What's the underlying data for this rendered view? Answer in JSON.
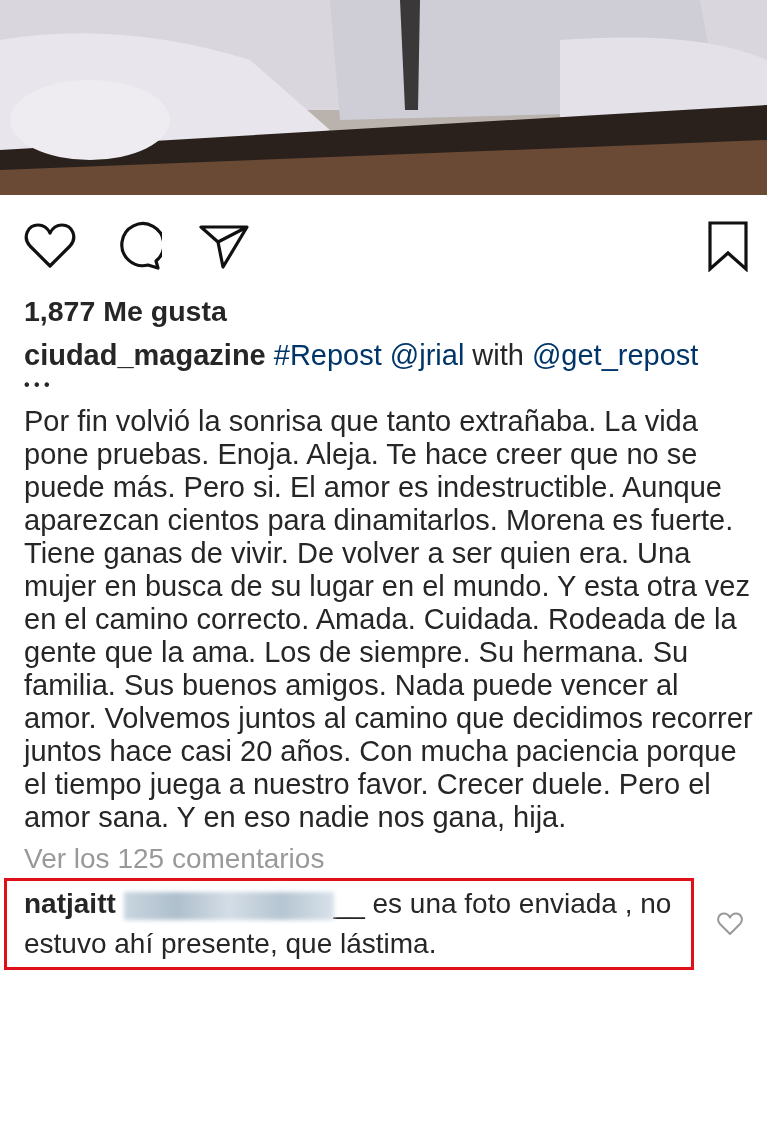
{
  "post": {
    "actions": [
      {
        "kind": "like"
      },
      {
        "kind": "comment"
      },
      {
        "kind": "share"
      },
      {
        "kind": "save"
      }
    ],
    "likes": "1,877 Me gusta",
    "header": [
      {
        "kind": "username",
        "text": "ciudad_magazine"
      },
      {
        "kind": "link",
        "text": "#Repost"
      },
      {
        "kind": "link",
        "text": "@jrial"
      },
      {
        "kind": "text",
        "text": "with"
      },
      {
        "kind": "link",
        "text": "@get_repost"
      }
    ],
    "ellipsis": "• • •",
    "caption": "Por fin volvió la sonrisa que tanto extrañaba. La vida pone pruebas. Enoja. Aleja. Te hace creer que no se puede más. Pero si. El amor es indestructible. Aunque aparezcan cientos para dinamitarlos. Morena es fuerte. Tiene ganas de vivir. De volver a ser quien era. Una mujer en busca de su lugar en el mundo. Y esta otra vez en el camino correcto. Amada. Cuidada. Rodeada de la gente que la ama. Los de siempre. Su hermana. Su familia. Sus buenos amigos. Nada puede vencer al amor. Volvemos juntos al camino que decidimos recorrer juntos hace casi 20 años. Con mucha paciencia porque el tiempo juega a nuestro favor. Crecer duele. Pero el amor sana. Y en eso nadie nos gana, hija.",
    "view_comments": "Ver los 125 comentarios",
    "comment": {
      "username": "natjaitt",
      "mention_blurred": true,
      "mention_tail": "__",
      "text": "es una foto enviada , no estuvo ahí presente, que lástima.",
      "highlighted": true,
      "liked": false
    }
  }
}
